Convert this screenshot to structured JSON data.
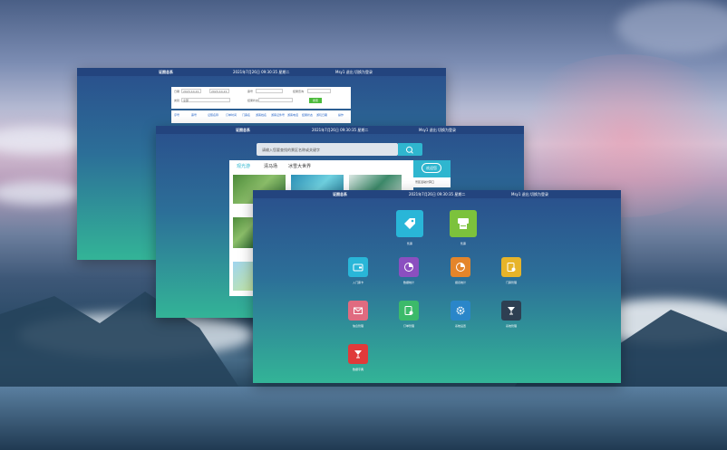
{
  "window_back": {
    "title": "证照总系",
    "datetime": "2021年7月26日 09:30:35 星期二",
    "user": "Msy1  退出  切换为登录",
    "form": {
      "date_label": "日期",
      "date_from": "2023-10-21",
      "date_to": "2023-10-21",
      "field_a": "票号",
      "field_b": "结果查询",
      "field_c": "类别",
      "field_c_value": "全部",
      "field_d": "选项",
      "field_d_value": "全部",
      "field_e": "结果状态",
      "button": "搜索"
    },
    "columns": [
      "序号",
      "票号",
      "证照名称",
      "订单时间",
      "门票名",
      "游客姓名",
      "游客证件号",
      "游客电话",
      "结果状态",
      "游玩日期",
      "操作"
    ]
  },
  "window_mid": {
    "title": "证照总系",
    "datetime": "2021年7月26日 09:30:35 星期二",
    "user": "Msy1  退出  切换为登录",
    "search_placeholder": "请输入您要查找的景区名称或关键字",
    "tabs": [
      "观光游",
      "清马场",
      "冰雪大世界"
    ],
    "promo_label": "景区活动计算口",
    "promo_badge": "欢迎您"
  },
  "window_front": {
    "title": "证照总系",
    "datetime": "2021年7月26日 09:30:35 星期二",
    "user": "Msy1  退出  切换为登录",
    "apps": [
      {
        "name": "tag-icon",
        "label": "售票",
        "color": "#29b6d8"
      },
      {
        "name": "ticket-machine-icon",
        "label": "售票",
        "color": "#7cc23c"
      },
      {
        "name": "wallet-icon",
        "label": "入门票卡",
        "color": "#29b6d8"
      },
      {
        "name": "pie-chart-icon",
        "label": "数据统计",
        "color": "#8b4fc0"
      },
      {
        "name": "pie-chart-icon",
        "label": "报表统计",
        "color": "#e4852a"
      },
      {
        "name": "card-settings-icon",
        "label": "门票管理",
        "color": "#e7b429"
      },
      {
        "name": "mail-icon",
        "label": "信息管理",
        "color": "#e06b80"
      },
      {
        "name": "card-gear-icon",
        "label": "订单管理",
        "color": "#3cba6a"
      },
      {
        "name": "gear-icon",
        "label": "系统设置",
        "color": "#2a86c9"
      },
      {
        "name": "drink-icon",
        "label": "系统管理",
        "color": "#2e3f52"
      },
      {
        "name": "drink-icon",
        "label": "数据字典",
        "color": "#e03a3a"
      }
    ]
  }
}
